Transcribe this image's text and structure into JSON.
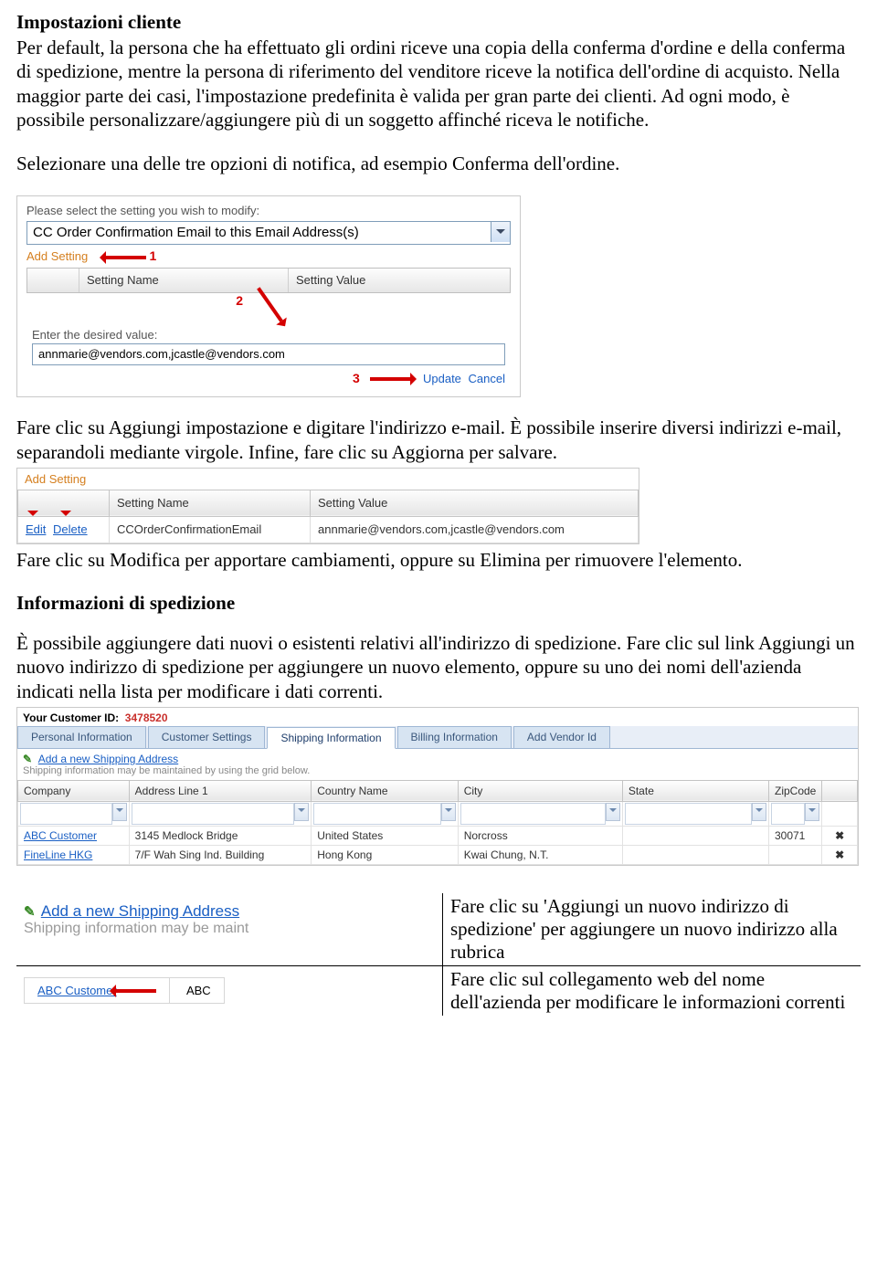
{
  "doc": {
    "h1": "Impostazioni cliente",
    "p1": "Per default, la persona che ha effettuato gli ordini riceve una copia della conferma d'ordine e della conferma di spedizione, mentre la persona di riferimento del venditore riceve la notifica dell'ordine di acquisto.  Nella maggior parte dei casi, l'impostazione predefinita è valida per gran parte dei clienti.  Ad ogni modo, è possibile personalizzare/aggiungere più di un soggetto affinché riceva le notifiche.",
    "p2": "Selezionare una delle tre opzioni di notifica, ad esempio Conferma dell'ordine.",
    "p3": "Fare clic su Aggiungi impostazione e digitare l'indirizzo e-mail.  È possibile inserire diversi indirizzi e-mail, separandoli mediante virgole.  Infine, fare clic su Aggiorna per salvare.",
    "p4": "Fare clic su Modifica per apportare cambiamenti, oppure su Elimina per rimuovere l'elemento.",
    "h2": "Informazioni di spedizione",
    "p5": "È possibile aggiungere dati nuovi o esistenti relativi all'indirizzo di spedizione.  Fare clic sul link Aggiungi un nuovo indirizzo di spedizione per aggiungere un nuovo elemento, oppure su uno dei nomi dell'azienda indicati nella lista per modificare i dati correnti."
  },
  "shot1": {
    "prompt": "Please select the setting you wish to modify:",
    "dropdown": "CC Order Confirmation Email to this Email Address(s)",
    "add": "Add Setting",
    "num1": "1",
    "num2": "2",
    "num3": "3",
    "col1": "Setting Name",
    "col2": "Setting Value",
    "enter": "Enter the desired value:",
    "value": "annmarie@vendors.com,jcastle@vendors.com",
    "update": "Update",
    "cancel": "Cancel"
  },
  "shot2": {
    "add": "Add Setting",
    "col0a": "Edit",
    "col0b": "Delete",
    "col1": "Setting Name",
    "col2": "Setting Value",
    "row": {
      "name": "CCOrderConfirmationEmail",
      "value": "annmarie@vendors.com,jcastle@vendors.com"
    }
  },
  "shot3": {
    "cid_label": "Your Customer ID:",
    "cid_value": "3478520",
    "tabs": [
      "Personal Information",
      "Customer Settings",
      "Shipping Information",
      "Billing Information",
      "Add Vendor Id"
    ],
    "addlink": "Add a new Shipping Address",
    "hint": "Shipping information may be maintained by using the grid below.",
    "cols": [
      "Company",
      "Address Line 1",
      "Country Name",
      "City",
      "State",
      "ZipCode"
    ],
    "rows": [
      {
        "company": "ABC Customer",
        "addr": "3145 Medlock Bridge",
        "country": "United States",
        "city": "Norcross",
        "state": "",
        "zip": "30071"
      },
      {
        "company": "FineLine HKG",
        "addr": "7/F Wah Sing Ind. Building",
        "country": "Hong Kong",
        "city": "Kwai Chung, N.T.",
        "state": "",
        "zip": ""
      }
    ]
  },
  "explain": {
    "r1": {
      "link": "Add a new Shipping Address",
      "sub": "Shipping information may be maint",
      "txt": "Fare clic su 'Aggiungi un nuovo indirizzo di spedizione' per aggiungere un nuovo indirizzo alla rubrica"
    },
    "r2": {
      "link": "ABC Customer",
      "cell2": "ABC",
      "txt": "Fare clic sul collegamento web del nome dell'azienda per modificare le informazioni correnti"
    }
  }
}
